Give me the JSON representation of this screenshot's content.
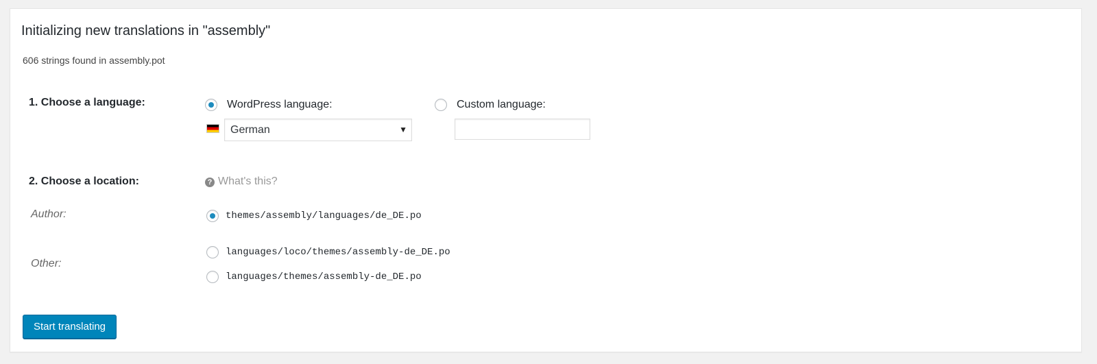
{
  "header": {
    "title": "Initializing new translations in \"assembly\"",
    "subtitle": "606 strings found in assembly.pot"
  },
  "language": {
    "step_label": "1. Choose a language:",
    "wp_option_label": "WordPress language:",
    "wp_selected": true,
    "selected_language": "German",
    "flag_icon": "de-flag-icon",
    "custom_option_label": "Custom language:",
    "custom_selected": false,
    "custom_value": ""
  },
  "location": {
    "step_label": "2. Choose a location:",
    "help_link": "What's this?",
    "author_label": "Author:",
    "author_paths": [
      {
        "path": "themes/assembly/languages/de_DE.po",
        "selected": true
      }
    ],
    "other_label": "Other:",
    "other_paths": [
      {
        "path": "languages/loco/themes/assembly-de_DE.po",
        "selected": false
      },
      {
        "path": "languages/themes/assembly-de_DE.po",
        "selected": false
      }
    ]
  },
  "actions": {
    "start_label": "Start translating"
  },
  "colors": {
    "accent": "#0085ba",
    "radio_dot": "#1e8cbe",
    "background": "#f1f1f1",
    "panel": "#ffffff"
  }
}
